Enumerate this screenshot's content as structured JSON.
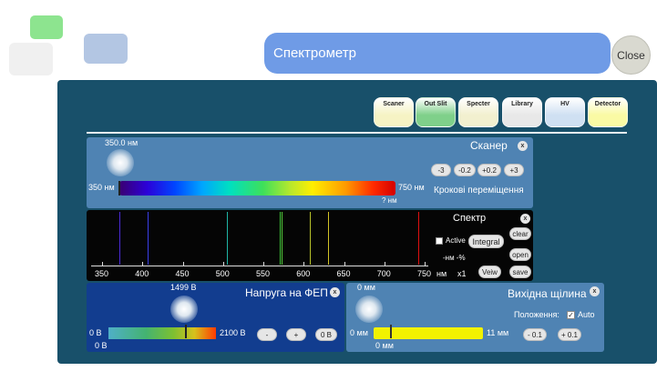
{
  "window": {
    "title": "Спектрометр",
    "close_label": "Close"
  },
  "modules": [
    {
      "label": "Scaner",
      "color": "#f6f3c4"
    },
    {
      "label": "Out Slit",
      "color": "#7fd08a"
    },
    {
      "label": "Specter",
      "color": "#f2f0cf"
    },
    {
      "label": "Library",
      "color": "#e8e8e8"
    },
    {
      "label": "HV",
      "color": "#cfe0f2"
    },
    {
      "label": "Detector",
      "color": "#fafaa4"
    }
  ],
  "scanner": {
    "title": "Сканер",
    "current_wavelength": "350.0 нм",
    "range_min": "350 нм",
    "range_max": "750 нм",
    "marker_readout": "? нм",
    "step_label": "Крокові переміщення",
    "step_buttons": [
      "-3",
      "-0.2",
      "+0.2",
      "+3"
    ]
  },
  "spectrum": {
    "title": "Спектр",
    "active_label": "Active",
    "integral_label": "Integral",
    "clear_label": "clear",
    "open_label": "open",
    "save_label": "save",
    "view_label": "Veiw",
    "readout": "-нм  -%",
    "unit": "нм",
    "zoom": "x1",
    "ticks": [
      "350",
      "400",
      "450",
      "500",
      "550",
      "600",
      "650",
      "700",
      "750"
    ],
    "lines_nm": [
      {
        "nm": 372,
        "color": "#4b2bd6"
      },
      {
        "nm": 406,
        "color": "#3a3ee8"
      },
      {
        "nm": 505,
        "color": "#1fb5a5"
      },
      {
        "nm": 570,
        "color": "#3ec83a"
      },
      {
        "nm": 573,
        "color": "#56c83a"
      },
      {
        "nm": 608,
        "color": "#b7c22a"
      },
      {
        "nm": 630,
        "color": "#d3c526"
      },
      {
        "nm": 742,
        "color": "#e01010"
      }
    ]
  },
  "voltage": {
    "title": "Напруга на ФЕП",
    "current": "1499 В",
    "min": "0 В",
    "max": "2100 В",
    "value": 0.7138,
    "value_bottom": "0 В",
    "minus_label": "-",
    "plus_label": "+",
    "zero_label": "0 В"
  },
  "slit": {
    "title": "Вихідна щілина",
    "current": "0 мм",
    "min": "0 мм",
    "max": "11 мм",
    "value": 0.0,
    "value_bottom": "0 мм",
    "position_label": "Положення:",
    "auto_label": "Auto",
    "minus_label": "- 0.1",
    "plus_label": "+ 0.1"
  }
}
